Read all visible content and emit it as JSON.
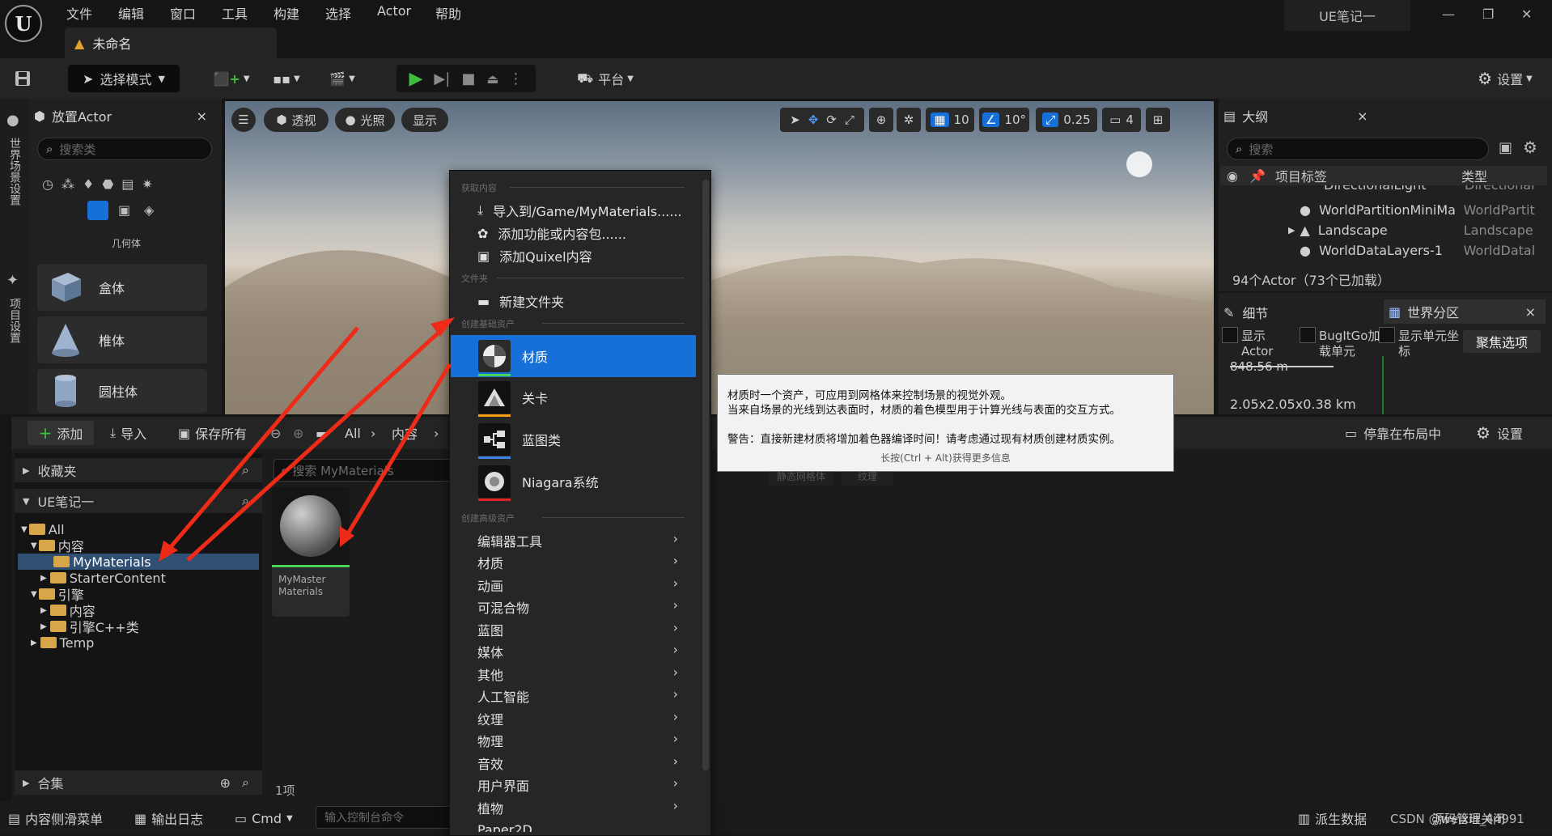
{
  "menubar": {
    "logo": "U",
    "items": [
      "文件",
      "编辑",
      "窗口",
      "工具",
      "构建",
      "选择",
      "Actor",
      "帮助"
    ],
    "project_name": "UE笔记一",
    "minimize": "—",
    "restore": "❐",
    "close": "✕"
  },
  "doc_tab": {
    "title": "未命名"
  },
  "toolbar": {
    "mode_label": "选择模式",
    "platform_label": "平台",
    "settings_label": "设置"
  },
  "left_strip": {
    "world_settings": "世界场景设置",
    "project_settings": "项目设置"
  },
  "place_actor": {
    "title": "放置Actor",
    "close": "×",
    "search_placeholder": "搜索类",
    "category_label": "几何体",
    "shapes": [
      "盒体",
      "椎体",
      "圆柱体"
    ]
  },
  "viewport": {
    "perspective": "透视",
    "lighting": "光照",
    "show": "显示",
    "grid_snap": "10",
    "rot_snap": "10°",
    "scale_snap": "0.25",
    "camera_speed": "4"
  },
  "outliner": {
    "title": "大纲",
    "close": "×",
    "search_placeholder": "搜索",
    "col_label": "项目标签",
    "col_type": "类型",
    "partial_row": {
      "label": "DirectionalLight",
      "type": "Directional"
    },
    "rows": [
      {
        "label": "WorldPartitionMiniMa",
        "type": "WorldPartit"
      },
      {
        "label": "Landscape",
        "type": "Landscape"
      },
      {
        "label": "WorldDataLayers-1",
        "type": "WorldDatal"
      }
    ],
    "count": "94个Actor（73个已加载）"
  },
  "details": {
    "tab_details": "细节",
    "tab_world_partition": "世界分区",
    "close": "×",
    "opt1": "显示Actor",
    "opt2": "BugItGo加载单元",
    "opt3": "显示单元坐标",
    "focus": "聚焦选项",
    "scale_text": "848.56 m",
    "size_text": "2.05x2.05x0.38 km"
  },
  "content_browser": {
    "add": "添加",
    "import": "导入",
    "save_all": "保存所有",
    "crumbs": [
      "All",
      "内容"
    ],
    "dock": "停靠在布局中",
    "settings": "设置",
    "favorites": "收藏夹",
    "project": "UE笔记一",
    "search_placeholder": "搜索 MyMaterials",
    "collections": "合集",
    "item_count": "1项",
    "filter1": "静态网格体",
    "filter2": "纹理",
    "tree": [
      {
        "label": "All",
        "depth": 0,
        "expanded": true
      },
      {
        "label": "内容",
        "depth": 1,
        "expanded": true
      },
      {
        "label": "MyMaterials",
        "depth": 2,
        "selected": true
      },
      {
        "label": "StarterContent",
        "depth": 2,
        "collapsed": true
      },
      {
        "label": "引擎",
        "depth": 1,
        "expanded": true
      },
      {
        "label": "内容",
        "depth": 2,
        "collapsed": true
      },
      {
        "label": "引擎C++类",
        "depth": 2,
        "collapsed": true
      },
      {
        "label": "Temp",
        "depth": 1,
        "collapsed": true
      }
    ],
    "asset": {
      "name": "MyMaster Materials"
    }
  },
  "context_menu": {
    "section_get": "获取内容",
    "import_to": "导入到/Game/MyMaterials......",
    "add_feature": "添加功能或内容包......",
    "add_quixel": "添加Quixel内容",
    "section_folder": "文件夹",
    "new_folder": "新建文件夹",
    "section_basic": "创建基础资产",
    "basic_assets": [
      {
        "label": "材质",
        "underline": "#4ad157",
        "highlighted": true
      },
      {
        "label": "关卡",
        "underline": "#f29d12"
      },
      {
        "label": "蓝图类",
        "underline": "#3c83e6"
      },
      {
        "label": "Niagara系统",
        "underline": "#e02424"
      }
    ],
    "section_advanced": "创建高级资产",
    "advanced": [
      "编辑器工具",
      "材质",
      "动画",
      "可混合物",
      "蓝图",
      "媒体",
      "其他",
      "人工智能",
      "纹理",
      "物理",
      "音效",
      "用户界面",
      "植物"
    ],
    "cut_off": "Paper2D"
  },
  "tooltip": {
    "line1": "材质时一个资产，可应用到网格体来控制场景的视觉外观。",
    "line2": "当来自场景的光线到达表面时，材质的着色模型用于计算光线与表面的交互方式。",
    "line3": "警告：直接新建材质将增加着色器编译时间！请考虑通过现有材质创建材质实例。",
    "hint": "长按(Ctrl + Alt)获得更多信息"
  },
  "statusbar": {
    "content_drawer": "内容侧滑菜单",
    "output_log": "输出日志",
    "cmd": "Cmd",
    "console_placeholder": "输入控制台命令",
    "derived_data": "派生数据",
    "source_control": "源码管理关闭",
    "watermark": "CSDN @weixin_44991"
  },
  "colors": {
    "accent": "#1670d8",
    "selection": "#2f4f73",
    "annotation": "#ee2b18",
    "play": "#3fbd3f"
  }
}
